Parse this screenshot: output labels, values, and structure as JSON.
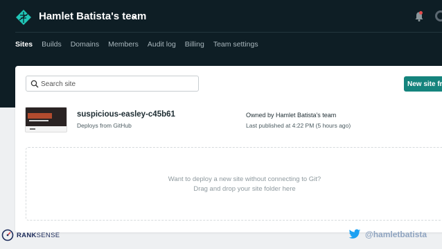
{
  "header": {
    "team_name": "Hamlet Batista's team"
  },
  "nav": {
    "items": [
      {
        "label": "Sites",
        "active": true
      },
      {
        "label": "Builds"
      },
      {
        "label": "Domains"
      },
      {
        "label": "Members"
      },
      {
        "label": "Audit log"
      },
      {
        "label": "Billing"
      },
      {
        "label": "Team settings"
      }
    ]
  },
  "search": {
    "placeholder": "Search site"
  },
  "new_site_button": "New site fro",
  "site": {
    "name": "suspicious-easley-c45b61",
    "source": "Deploys from GitHub",
    "owner": "Owned by Hamlet Batista's team",
    "published": "Last published at 4:22 PM (5 hours ago)"
  },
  "dropzone": {
    "line1": "Want to deploy a new site without connecting to Git?",
    "line2": "Drag and drop your site folder here"
  },
  "footer": {
    "brand_rank": "RANK",
    "brand_sense": "SENSE",
    "handle": "@hamletbatista"
  },
  "colors": {
    "topbar": "#0e1e25",
    "accent_button": "#15847d",
    "notification_dot": "#e24b4b",
    "twitter": "#1da1f2"
  }
}
